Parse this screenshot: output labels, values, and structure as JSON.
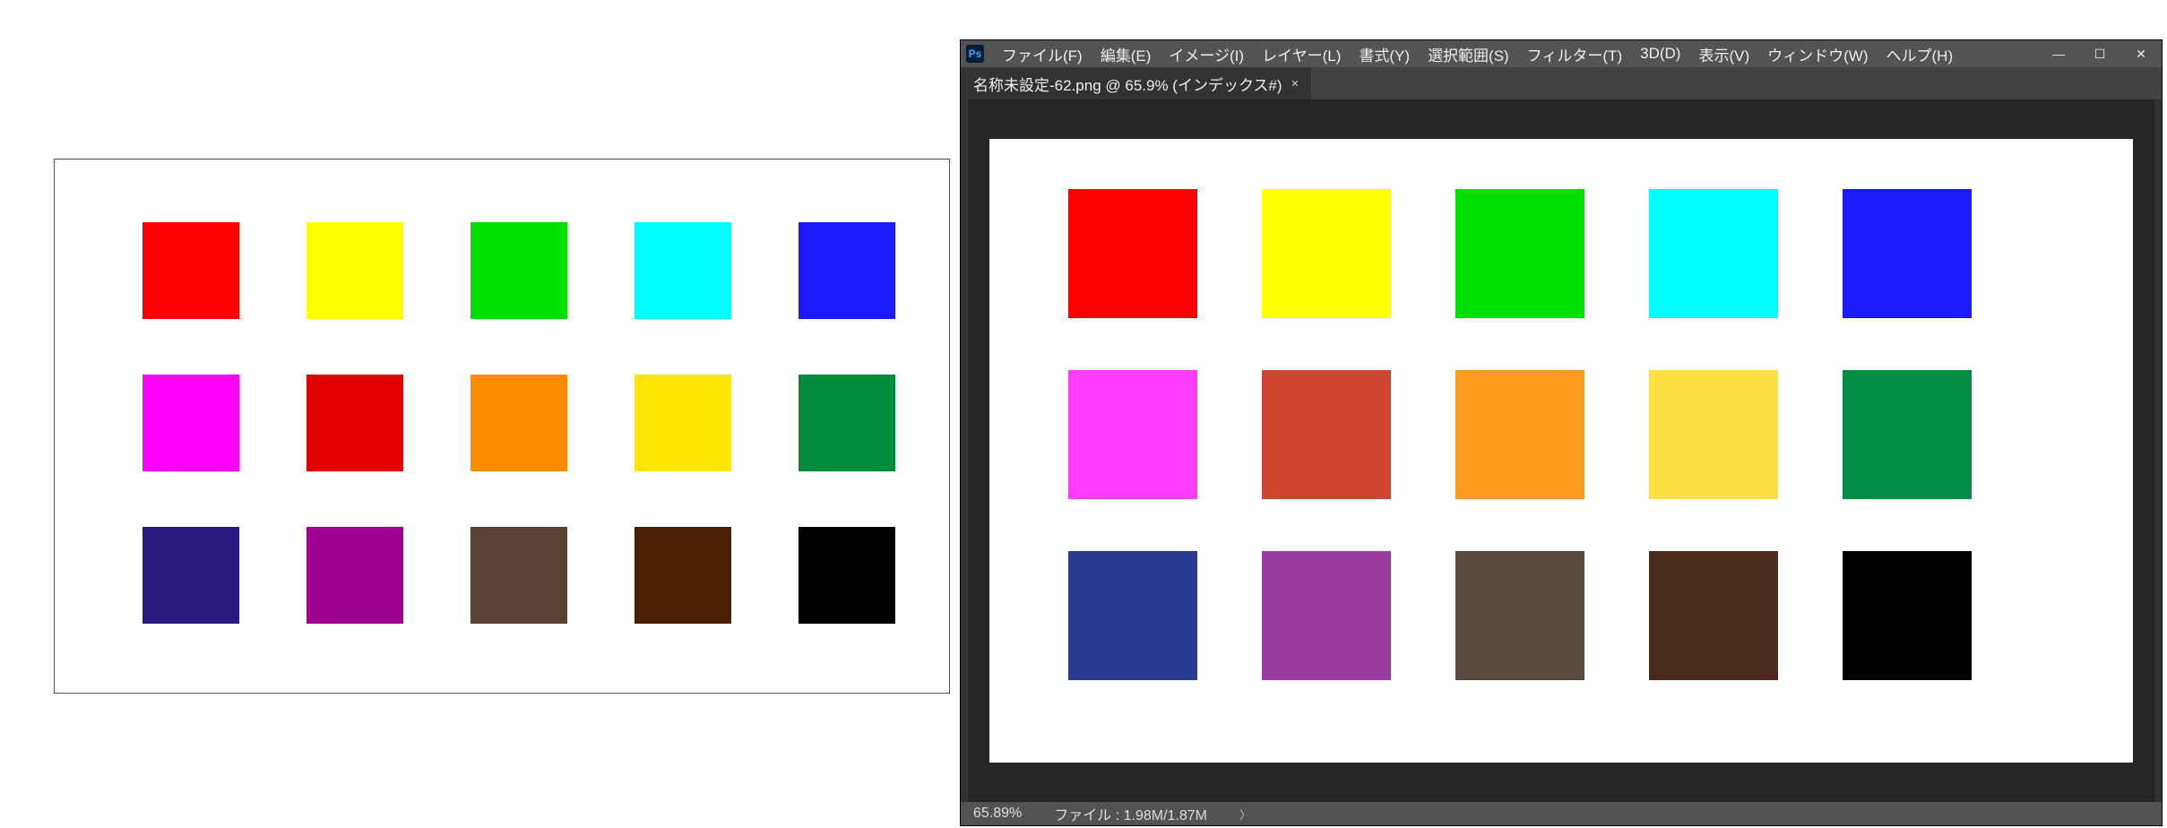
{
  "reference": {
    "swatches": [
      "#ff0000",
      "#ffff00",
      "#00e000",
      "#00ffff",
      "#1a1aff",
      "#ff00ff",
      "#e00000",
      "#ff8c00",
      "#ffe600",
      "#008c3c",
      "#2a1a80",
      "#a00090",
      "#5a3f33",
      "#4a1e00",
      "#000000"
    ]
  },
  "photoshop": {
    "logo": "Ps",
    "menus": [
      "ファイル(F)",
      "編集(E)",
      "イメージ(I)",
      "レイヤー(L)",
      "書式(Y)",
      "選択範囲(S)",
      "フィルター(T)",
      "3D(D)",
      "表示(V)",
      "ウィンドウ(W)",
      "ヘルプ(H)"
    ],
    "window_controls": {
      "min": "—",
      "max": "☐",
      "close": "✕"
    },
    "tab": {
      "title": "名称未設定-62.png @ 65.9% (インデックス#)",
      "close": "×"
    },
    "swatches": [
      "#ff0000",
      "#ffff00",
      "#00e000",
      "#00ffff",
      "#1a1aff",
      "#ff3cff",
      "#d04430",
      "#ff9a20",
      "#ffe040",
      "#008c44",
      "#2a3a90",
      "#9a3aa0",
      "#5a4a40",
      "#4a2a1a",
      "#000000"
    ],
    "statusbar": {
      "zoom": "65.89%",
      "info": "ファイル : 1.98M/1.87M"
    }
  }
}
